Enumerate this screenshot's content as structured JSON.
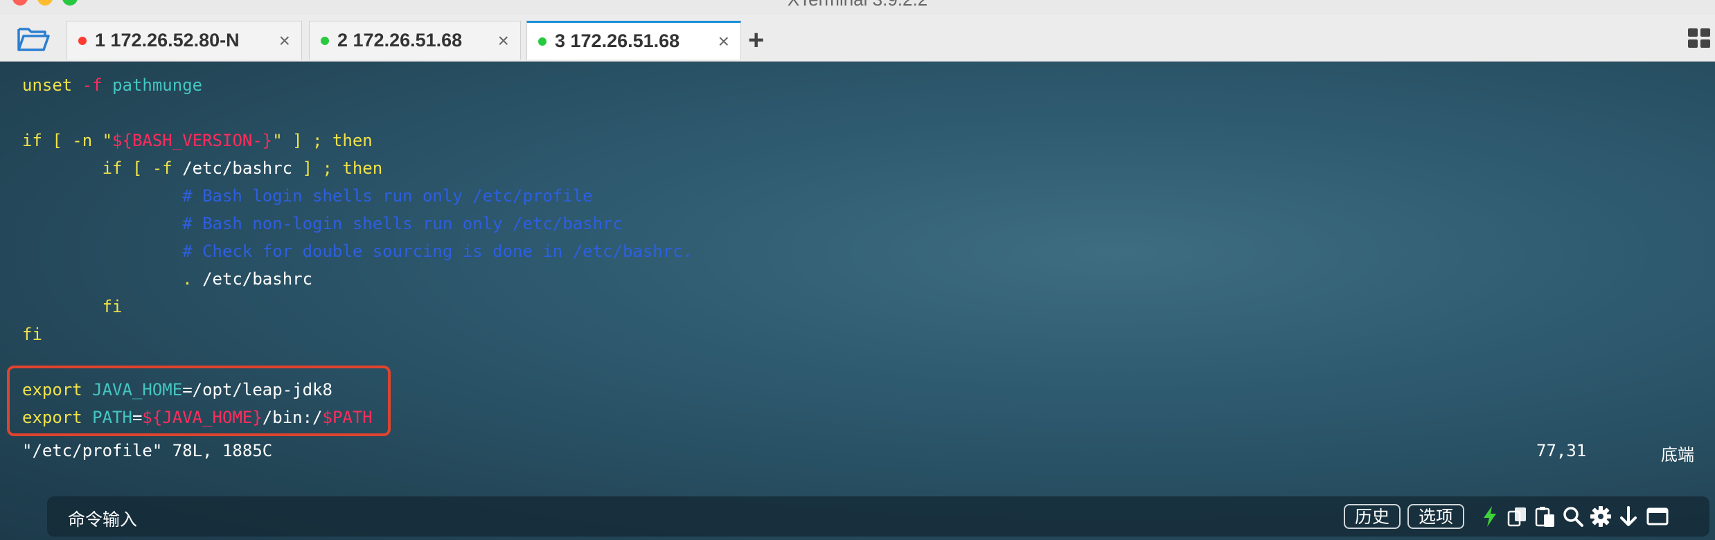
{
  "window": {
    "title": "XTerminal 3.9.2.2"
  },
  "tabs": [
    {
      "number": "1",
      "label": "1 172.26.52.80-N",
      "status_color": "#ff3b30",
      "close": "×"
    },
    {
      "number": "2",
      "label": "2 172.26.51.68",
      "status_color": "#27c93f",
      "close": "×"
    },
    {
      "number": "3",
      "label": "3 172.26.51.68",
      "status_color": "#27c93f",
      "close": "×",
      "active": true
    }
  ],
  "new_tab": "+",
  "terminal": {
    "lines": [
      {
        "segments": [
          {
            "t": "unset ",
            "c": "y"
          },
          {
            "t": "-f ",
            "c": "r"
          },
          {
            "t": "pathmunge",
            "c": "g"
          }
        ]
      },
      {
        "segments": []
      },
      {
        "segments": [
          {
            "t": "if [ -n \"",
            "c": "y"
          },
          {
            "t": "${BASH_VERSION-}",
            "c": "r"
          },
          {
            "t": "\" ] ; then",
            "c": "y"
          }
        ]
      },
      {
        "segments": [
          {
            "t": "        if [ -f ",
            "c": "y"
          },
          {
            "t": "/etc/bashrc",
            "c": "w"
          },
          {
            "t": " ] ; then",
            "c": "y"
          }
        ]
      },
      {
        "segments": [
          {
            "t": "                # Bash login shells run only /etc/profile",
            "c": "b"
          }
        ]
      },
      {
        "segments": [
          {
            "t": "                # Bash non-login shells run only /etc/bashrc",
            "c": "b"
          }
        ]
      },
      {
        "segments": [
          {
            "t": "                # Check for double sourcing is done in /etc/bashrc.",
            "c": "b"
          }
        ]
      },
      {
        "segments": [
          {
            "t": "                . ",
            "c": "y"
          },
          {
            "t": "/etc/bashrc",
            "c": "w"
          }
        ]
      },
      {
        "segments": [
          {
            "t": "        fi",
            "c": "y"
          }
        ]
      },
      {
        "segments": [
          {
            "t": "fi",
            "c": "y"
          }
        ]
      },
      {
        "segments": []
      },
      {
        "segments": [
          {
            "t": "export ",
            "c": "y"
          },
          {
            "t": "JAVA_HOME",
            "c": "g"
          },
          {
            "t": "=/opt/leap-jdk8",
            "c": "w"
          }
        ]
      },
      {
        "segments": [
          {
            "t": "export ",
            "c": "y"
          },
          {
            "t": "PATH",
            "c": "g"
          },
          {
            "t": "=",
            "c": "w"
          },
          {
            "t": "${JAVA_HOME}",
            "c": "r"
          },
          {
            "t": "/bin:/",
            "c": "w"
          },
          {
            "t": "$PATH",
            "c": "r"
          }
        ]
      }
    ],
    "status_file": "\"/etc/profile\" 78L, 1885C",
    "status_position": "77,31",
    "status_scroll": "底端"
  },
  "command_bar": {
    "placeholder": "命令输入",
    "history_label": "历史",
    "options_label": "选项"
  },
  "colors": {
    "keyword": "#f0e24a",
    "identifier": "#45c6c1",
    "variable": "#ff2d5c",
    "comment": "#2d5fe0",
    "highlight_box": "#e0432e",
    "active_tab_accent": "#1a8fd6"
  }
}
